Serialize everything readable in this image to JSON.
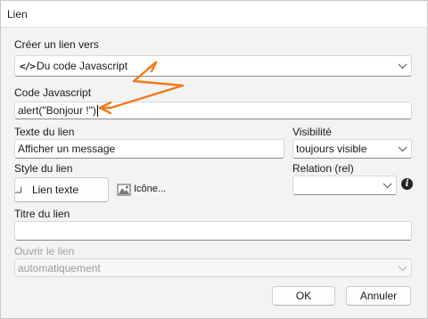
{
  "dialog": {
    "title": "Lien"
  },
  "link_type": {
    "label": "Créer un lien vers",
    "value": "Du code Javascript",
    "icon": "code-icon"
  },
  "js_code": {
    "label": "Code Javascript",
    "value": "alert(\"Bonjour !\")"
  },
  "link_text": {
    "label": "Texte du lien",
    "value": "Afficher un message"
  },
  "visibility": {
    "label": "Visibilité",
    "value": "toujours visible"
  },
  "link_style": {
    "label": "Style du lien",
    "value": "Lien texte",
    "icon_button_label": "Icône..."
  },
  "relation": {
    "label": "Relation (rel)",
    "value": ""
  },
  "link_title": {
    "label": "Titre du lien",
    "value": ""
  },
  "open_link": {
    "label": "Ouvrir le lien",
    "value": "automatiquement"
  },
  "buttons": {
    "ok": "OK",
    "cancel": "Annuler"
  },
  "annotation_color": "#f07a1a"
}
